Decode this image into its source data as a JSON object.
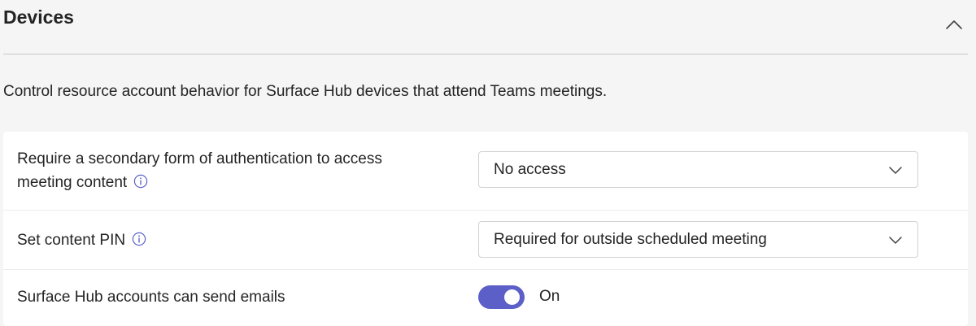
{
  "section": {
    "title": "Devices",
    "collapse_icon": "chevron-up-icon",
    "description": "Control resource account behavior for Surface Hub devices that attend Teams meetings."
  },
  "settings": [
    {
      "label_line1": "Require a secondary form of authentication to access",
      "label_line2": "meeting content",
      "info_icon": "info-icon",
      "control": "dropdown",
      "value": "No access",
      "chevron_icon": "chevron-down-icon"
    },
    {
      "label": "Set content PIN",
      "info_icon": "info-icon",
      "control": "dropdown",
      "value": "Required for outside scheduled meeting",
      "chevron_icon": "chevron-down-icon"
    },
    {
      "label": "Surface Hub accounts can send emails",
      "control": "toggle",
      "checked": true,
      "state_label": "On"
    }
  ],
  "colors": {
    "toggle_on": "#5b5fc7",
    "card_background": "#ffffff",
    "page_background": "#f5f5f5"
  }
}
